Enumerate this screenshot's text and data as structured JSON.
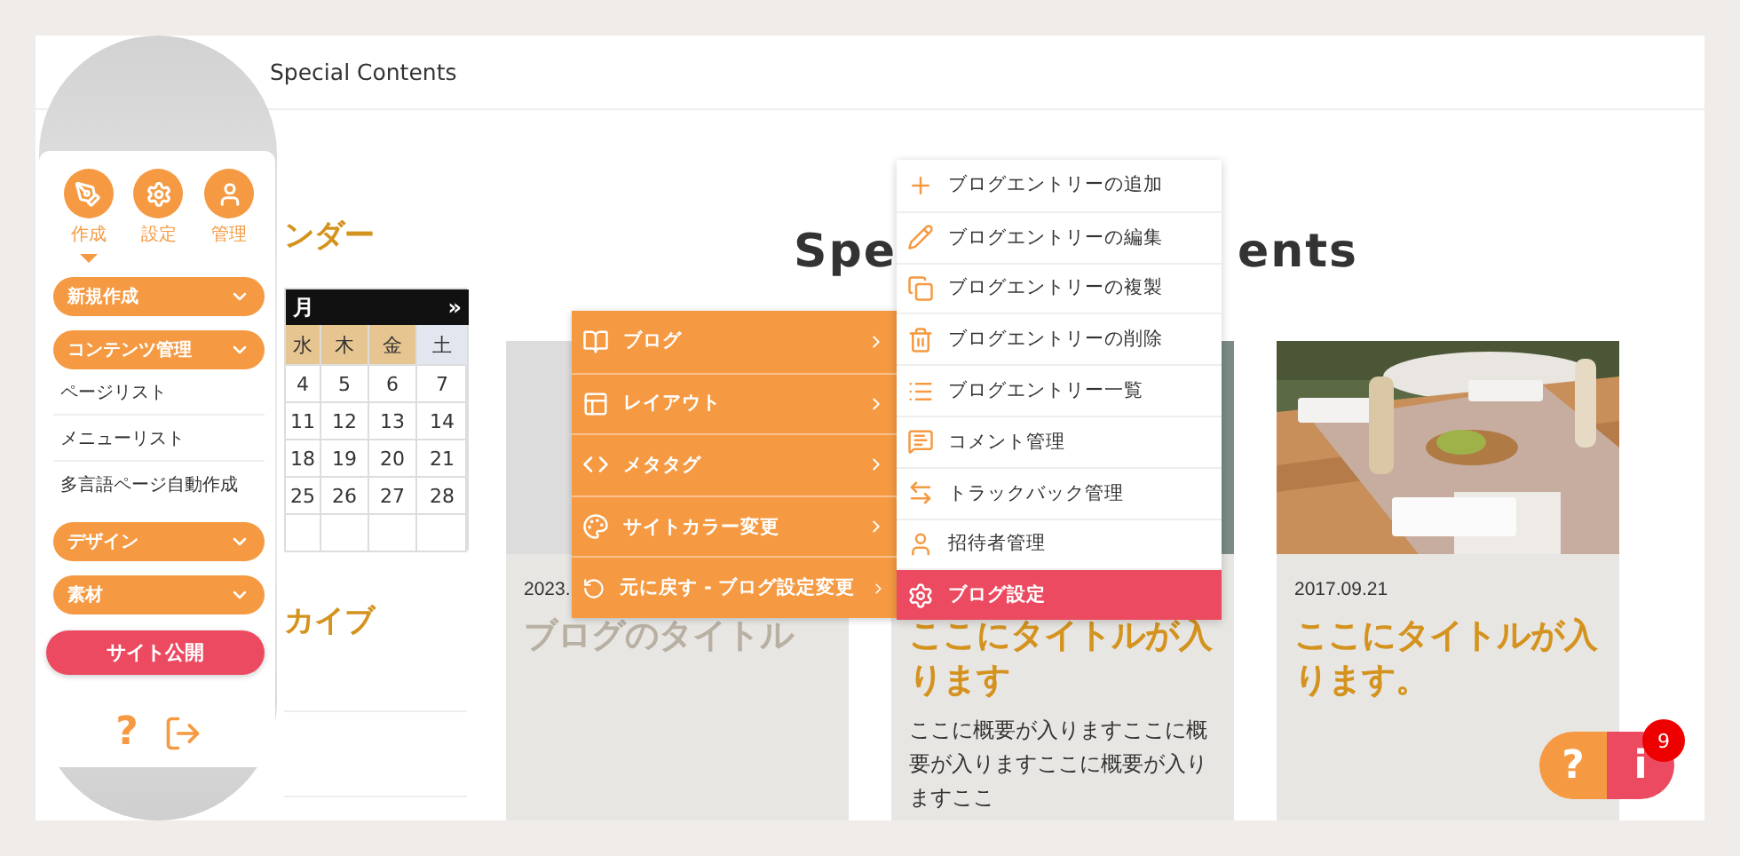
{
  "header": {
    "title": "Special Contents"
  },
  "sidebar": {
    "tabs": [
      {
        "label": "作成",
        "selected": true
      },
      {
        "label": "設定",
        "selected": false
      },
      {
        "label": "管理",
        "selected": false
      }
    ],
    "sections": [
      {
        "label": "新規作成"
      },
      {
        "label": "コンテンツ管理",
        "items": [
          "ページリスト",
          "メニューリスト",
          "多言語ページ自動作成"
        ]
      },
      {
        "label": "デザイン"
      },
      {
        "label": "素材"
      }
    ],
    "publish_button": "サイト公開",
    "help": "?"
  },
  "calendar": {
    "title": "ンダー",
    "month": "月",
    "next": "»",
    "weekdays": [
      "水",
      "木",
      "金",
      "土"
    ],
    "weeks": [
      [
        "4",
        "5",
        "6",
        "7"
      ],
      [
        "11",
        "12",
        "13",
        "14"
      ],
      [
        "18",
        "19",
        "20",
        "21"
      ],
      [
        "25",
        "26",
        "27",
        "28"
      ]
    ]
  },
  "archive": {
    "title": "カイブ"
  },
  "main": {
    "heading_parts": [
      "Spe",
      "ents"
    ],
    "cards": [
      {
        "kind": "placeholder",
        "date": "2023.",
        "title": "ブログのタイトル",
        "color": "#b9b0a4"
      },
      {
        "kind": "picture",
        "title": "ここにタイトルが入ります",
        "color": "#d4931e",
        "excerpt": "ここに概要が入りますここに概要が入りますここに概要が入りますここ"
      },
      {
        "kind": "picture",
        "date": "2017.09.21",
        "title": "ここにタイトルが入ります。",
        "color": "#d4931e"
      }
    ]
  },
  "menu": {
    "items": [
      {
        "label": "ブログ"
      },
      {
        "label": "レイアウト"
      },
      {
        "label": "メタタグ"
      },
      {
        "label": "サイトカラー変更"
      },
      {
        "label": "元に戻す - ブログ設定変更"
      }
    ]
  },
  "submenu": {
    "items": [
      {
        "label": "ブログエントリーの追加",
        "selected": false
      },
      {
        "label": "ブログエントリーの編集",
        "selected": false
      },
      {
        "label": "ブログエントリーの複製",
        "selected": false
      },
      {
        "label": "ブログエントリーの削除",
        "selected": false
      },
      {
        "label": "ブログエントリー一覧",
        "selected": false
      },
      {
        "label": "コメント管理",
        "selected": false
      },
      {
        "label": "トラックバック管理",
        "selected": false
      },
      {
        "label": "招待者管理",
        "selected": false
      },
      {
        "label": "ブログ設定",
        "selected": true
      }
    ]
  },
  "help_widget": {
    "help": "?",
    "info": "i",
    "badge": "9"
  }
}
